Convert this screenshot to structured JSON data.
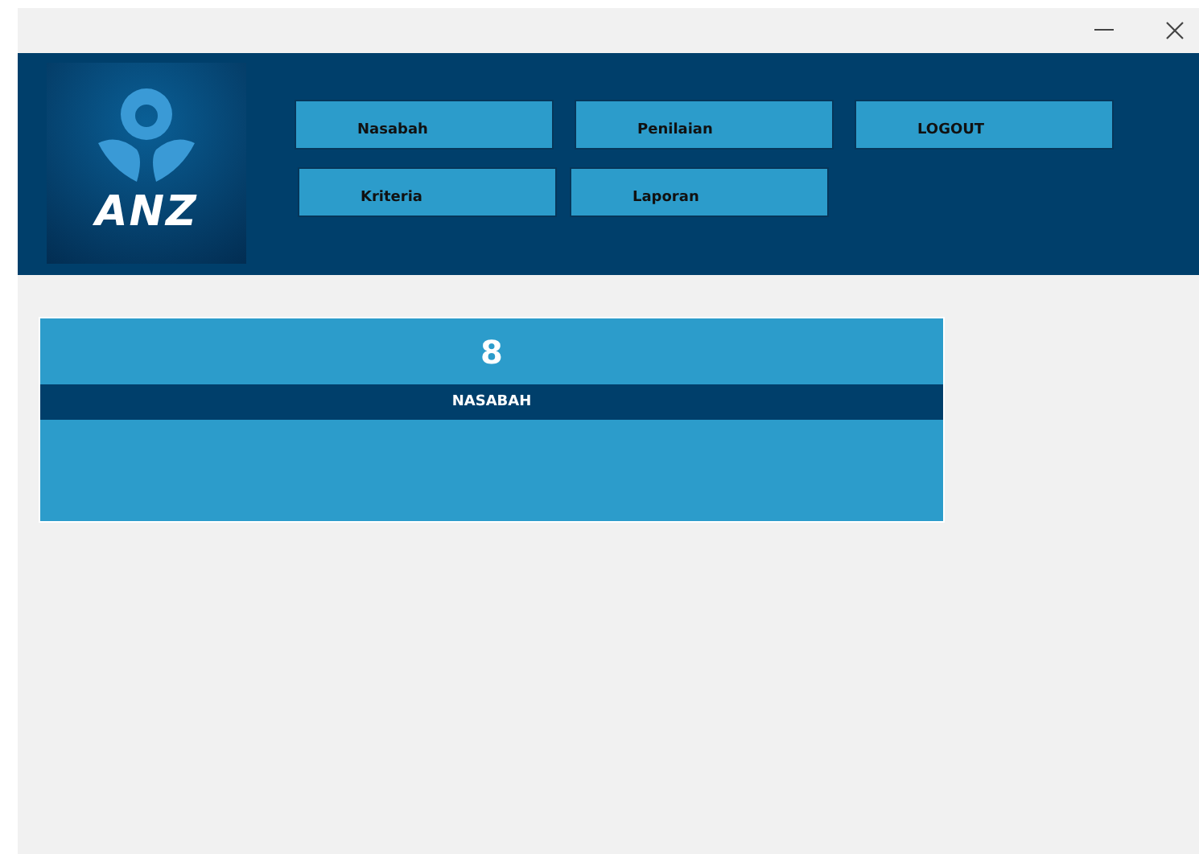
{
  "header": {
    "logo": {
      "text": "ANZ"
    },
    "menu_rows": [
      [
        "Nasabah",
        "Penilaian",
        "LOGOUT"
      ],
      [
        "Kriteria",
        "Laporan"
      ]
    ]
  },
  "summary_card": {
    "count": "8",
    "label": "NASABAH"
  }
}
